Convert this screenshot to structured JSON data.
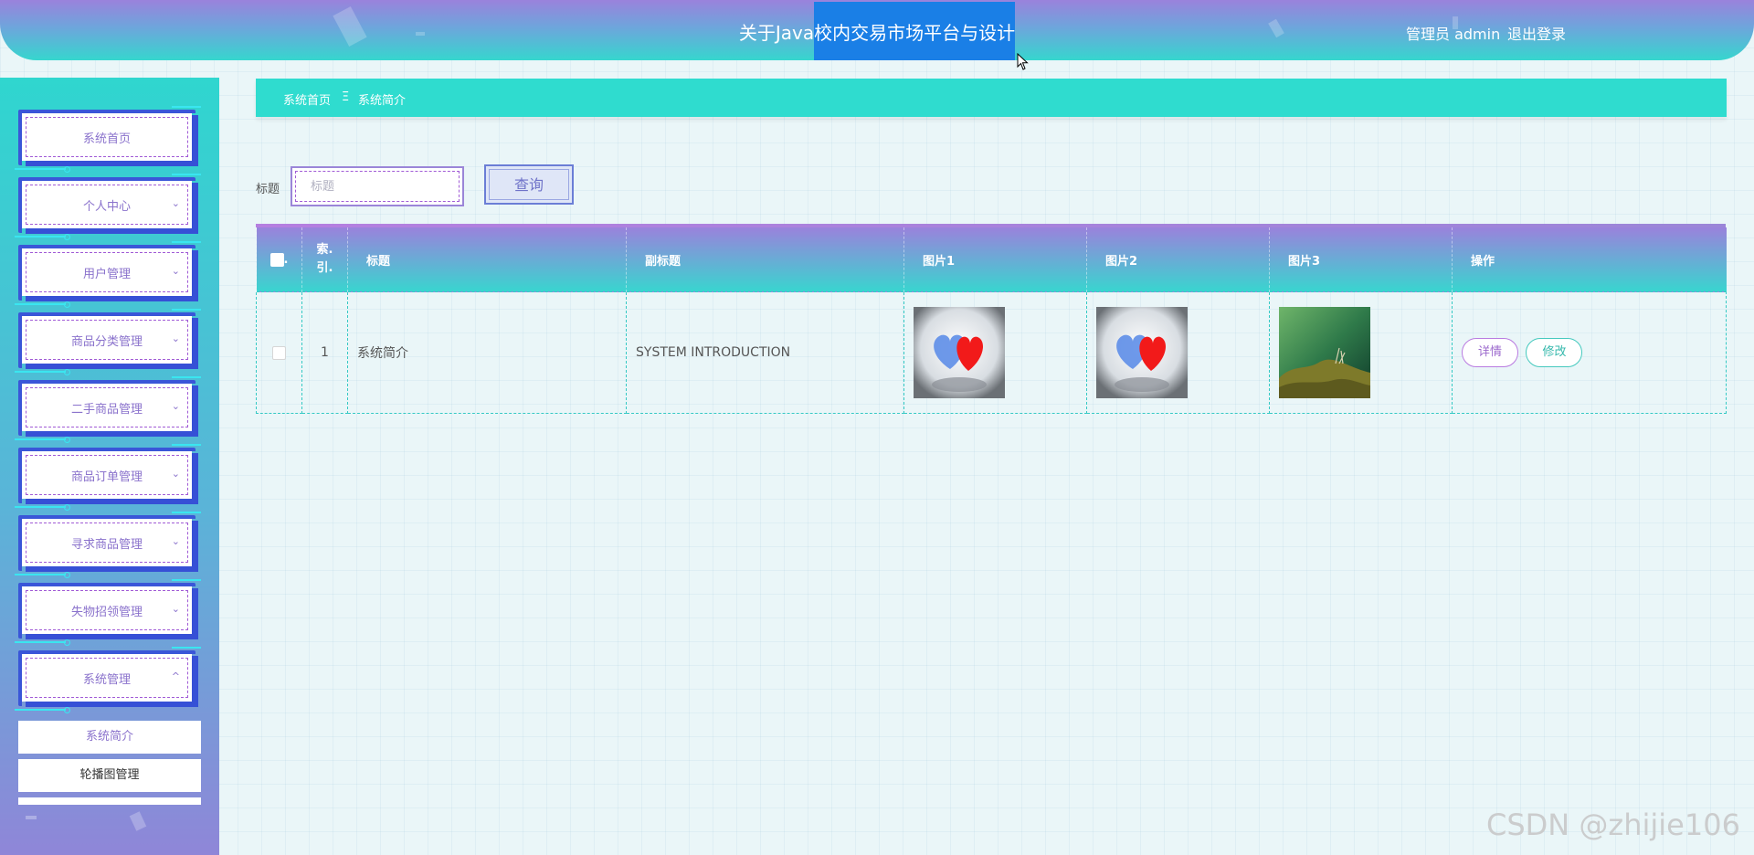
{
  "header": {
    "title_prefix": "关于",
    "title_highlight_a": "Java",
    "title_highlight_b": "校内交易市场平台与设计",
    "user_text": "管理员 admin",
    "logout_label": "退出登录"
  },
  "sidebar": {
    "items": [
      {
        "label": "系统首页",
        "expandable": false
      },
      {
        "label": "个人中心",
        "expandable": true,
        "chevron": "⌄"
      },
      {
        "label": "用户管理",
        "expandable": true,
        "chevron": "⌄"
      },
      {
        "label": "商品分类管理",
        "expandable": true,
        "chevron": "⌄"
      },
      {
        "label": "二手商品管理",
        "expandable": true,
        "chevron": "⌄"
      },
      {
        "label": "商品订单管理",
        "expandable": true,
        "chevron": "⌄"
      },
      {
        "label": "寻求商品管理",
        "expandable": true,
        "chevron": "⌄"
      },
      {
        "label": "失物招领管理",
        "expandable": true,
        "chevron": "⌄"
      },
      {
        "label": "系统管理",
        "expandable": true,
        "chevron": "^"
      }
    ],
    "sub_items": [
      {
        "label": "系统简介",
        "active": true
      },
      {
        "label": "轮播图管理",
        "active": false
      }
    ]
  },
  "breadcrumb": {
    "home": "系统首页",
    "separator": "Ξ",
    "current": "系统简介"
  },
  "search": {
    "label": "标题",
    "placeholder": "标题",
    "button_label": "查询"
  },
  "table": {
    "columns": [
      "",
      "索引",
      "标题",
      "副标题",
      "图片1",
      "图片2",
      "图片3",
      "操作"
    ],
    "rows": [
      {
        "index": "1",
        "title": "系统简介",
        "subtitle": "SYSTEM INTRODUCTION",
        "images": [
          "hearts-image",
          "hearts-image",
          "moss-image"
        ],
        "actions": [
          "详情",
          "修改"
        ]
      }
    ]
  },
  "colors": {
    "accent_teal": "#2fdccf",
    "accent_purple": "#9a82dc",
    "highlight_blue": "#1a7fe6"
  },
  "watermark": "CSDN @zhijie106"
}
